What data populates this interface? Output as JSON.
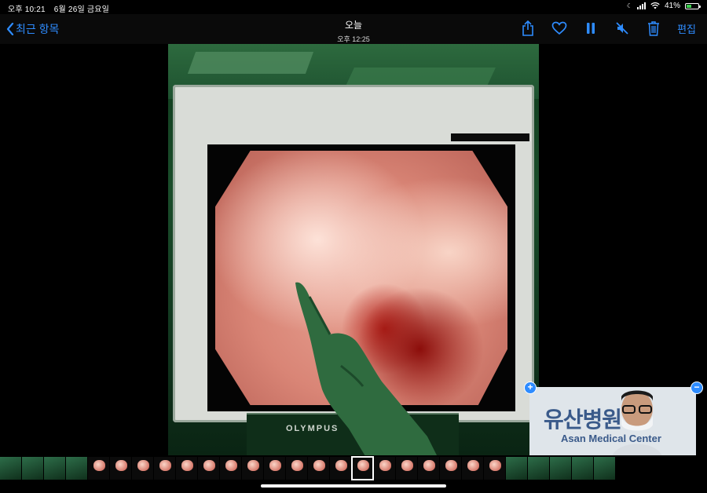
{
  "status_bar": {
    "time": "오후 10:21",
    "date": "6월 26일 금요일",
    "battery_percent": "41%",
    "battery_level": 0.41
  },
  "nav": {
    "back_label": "최근 항목",
    "title": "오늘",
    "subtitle": "오후 12:25",
    "edit_label": "편집",
    "icons": [
      "share-icon",
      "heart-icon",
      "pause-icon",
      "mute-icon",
      "trash-icon"
    ]
  },
  "scene": {
    "monitor_brand": "OLYMPUS"
  },
  "pip": {
    "sign_line1": "유산병원",
    "sign_line2": "Asan Medical Center",
    "sign_visible": "al Center",
    "add_label": "+",
    "remove_label": "−"
  },
  "colors": {
    "accent": "#2e8cff",
    "battery": "#3ccf4e"
  }
}
